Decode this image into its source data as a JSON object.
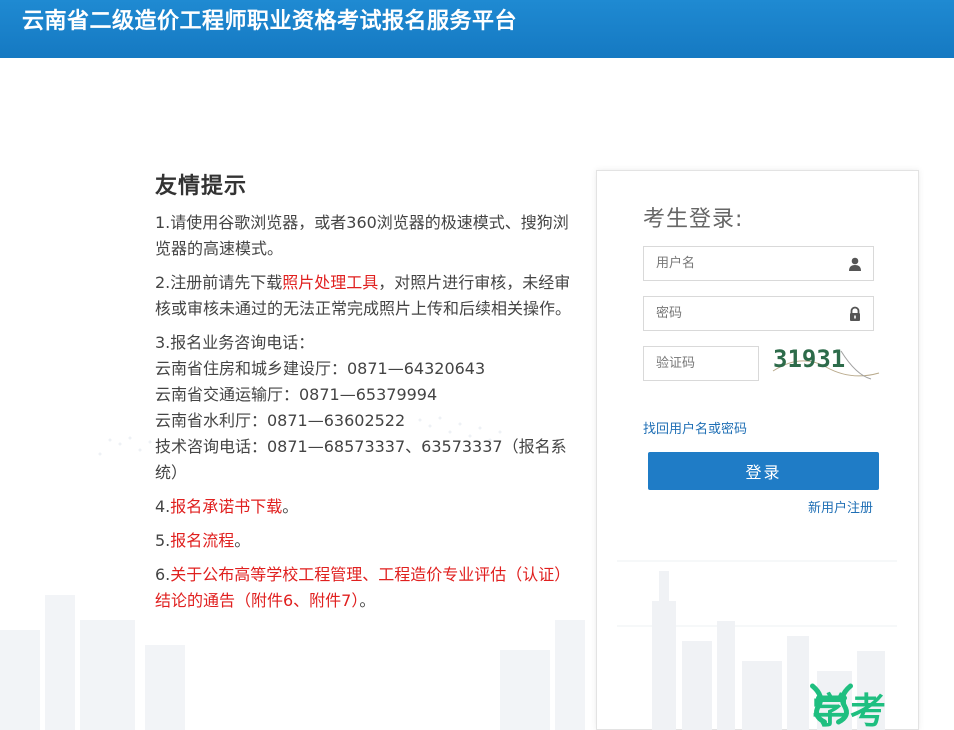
{
  "header": {
    "title": "云南省二级造价工程师职业资格考试报名服务平台",
    "bg_color": "#1579c2"
  },
  "notice": {
    "title": "友情提示",
    "item1": "1.请使用谷歌浏览器，或者360浏览器的极速模式、搜狗浏览器的高速模式。",
    "item2_prefix": "2.注册前请先下载",
    "item2_link": "照片处理工具",
    "item2_suffix": "，对照片进行审核，未经审核或审核未通过的无法正常完成照片上传和后续相关操作。",
    "item3_title": "3.报名业务咨询电话：",
    "item3_line1": "云南省住房和城乡建设厅：0871—64320643",
    "item3_line2": "云南省交通运输厅：0871—65379994",
    "item3_line3": "云南省水利厅：0871—63602522",
    "item3_line4": "技术咨询电话：0871—68573337、63573337（报名系统）",
    "item4_prefix": "4.",
    "item4_link": "报名承诺书下载",
    "item4_suffix": "。",
    "item5_prefix": "5.",
    "item5_link": "报名流程",
    "item5_suffix": "。",
    "item6_prefix": "6.",
    "item6_link": "关于公布高等学校工程管理、工程造价专业评估（认证）结论的通告（附件6、附件7）",
    "item6_suffix": "。",
    "link_color": "#e0201f"
  },
  "login": {
    "title": "考生登录:",
    "username_placeholder": "用户名",
    "username_icon": "user-icon",
    "password_placeholder": "密码",
    "password_icon": "lock-icon",
    "captcha_placeholder": "验证码",
    "captcha_code": "31931",
    "forgot_label": "找回用户名或密码",
    "login_button": "登录",
    "register_label": "新用户注册",
    "button_color": "#1f7cc6"
  },
  "watermark": {
    "text": "学考"
  }
}
